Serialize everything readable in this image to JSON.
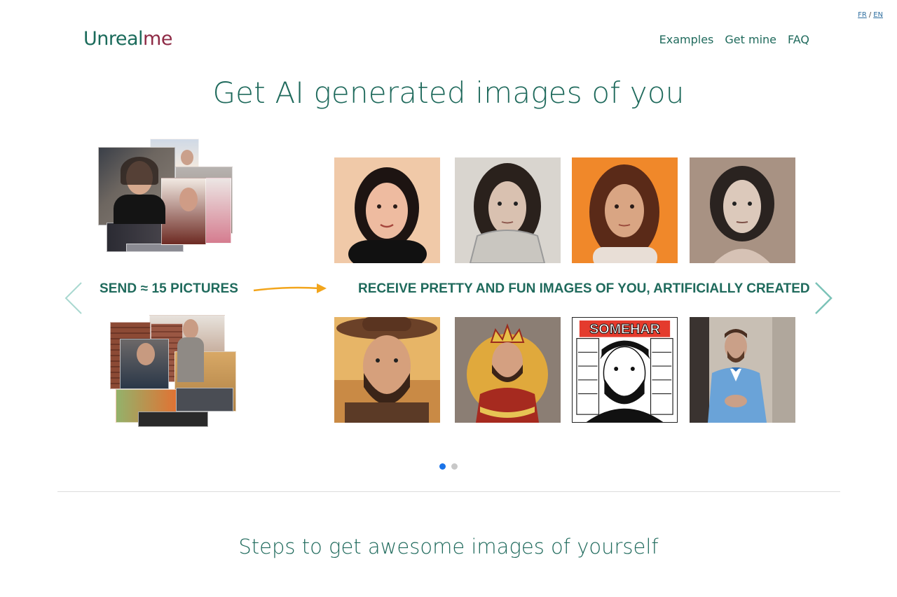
{
  "lang_switch": {
    "fr": "FR",
    "sep": "/",
    "en": "EN"
  },
  "logo": {
    "part1": "Unreal",
    "part2": "me"
  },
  "nav": {
    "examples": "Examples",
    "get_mine": "Get mine",
    "faq": "FAQ"
  },
  "hero": {
    "title": "Get AI generated images of you"
  },
  "carousel": {
    "send_label": "SEND ≈ 15 PICTURES",
    "receive_label": "RECEIVE PRETTY AND FUN IMAGES OF YOU, ARTIFICIALLY CREATED",
    "slide_count": 2,
    "active_slide": 1,
    "tiles_top": [
      "portrait-illustration-woman",
      "portrait-armored-woman",
      "portrait-orange-background-woman",
      "portrait-sketch-woman"
    ],
    "tiles_bottom": [
      "portrait-cowboy-man",
      "portrait-king-man",
      "portrait-comic-man",
      "portrait-blue-suit-man"
    ],
    "comic_text": "SOMEHAR"
  },
  "steps": {
    "title": "Steps to get awesome images of yourself"
  },
  "colors": {
    "primary": "#1f6a5c",
    "logo_accent": "#8e2a45",
    "arrow": "#f2a51c",
    "dot_active": "#1a73e8",
    "chevron": "#7cc3b8"
  }
}
